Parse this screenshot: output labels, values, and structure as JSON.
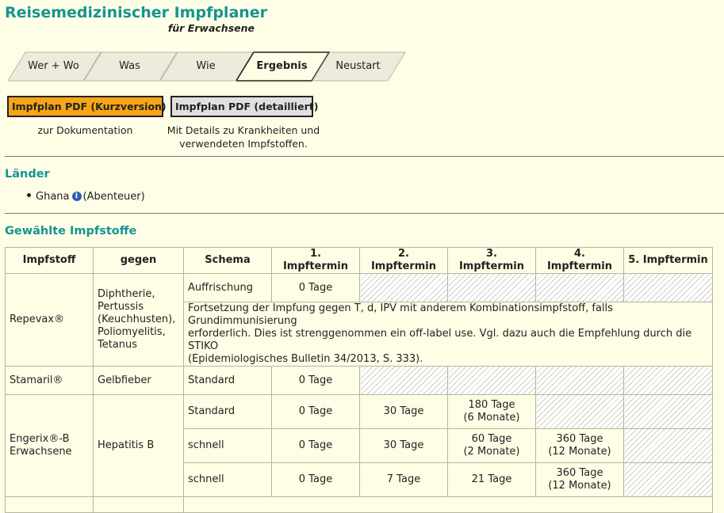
{
  "header": {
    "title": "Reisemedizinischer Impfplaner",
    "subtitle": "für Erwachsene"
  },
  "tabs": [
    {
      "label": "Wer + Wo",
      "active": false
    },
    {
      "label": "Was",
      "active": false
    },
    {
      "label": "Wie",
      "active": false
    },
    {
      "label": "Ergebnis",
      "active": true
    },
    {
      "label": "Neustart",
      "active": false
    }
  ],
  "pdf": {
    "short_label": "Impfplan PDF (Kurzversion)",
    "short_desc": "zur Dokumentation",
    "detail_label": "Impfplan PDF (detailliert)",
    "detail_desc_line1": "Mit Details zu Krankheiten und",
    "detail_desc_line2": "verwendeten Impfstoffen.",
    "short_color": "#f7a416",
    "detail_color": "#e2e0df"
  },
  "countries": {
    "heading": "Länder",
    "items": [
      {
        "name": "Ghana",
        "note": "(Abenteuer)"
      }
    ]
  },
  "vaccines": {
    "heading": "Gewählte Impfstoffe",
    "columns": [
      "Impfstoff",
      "gegen",
      "Schema",
      "1. Impftermin",
      "2. Impftermin",
      "3. Impftermin",
      "4. Impftermin",
      "5. Impftermin"
    ],
    "repevax": {
      "name": "Repevax®",
      "gegen_lines": [
        "Diphtherie,",
        "Pertussis",
        "(Keuchhusten),",
        "Poliomyelitis,",
        "Tetanus"
      ],
      "schema": "Auffrischung",
      "t1": "0 Tage",
      "note_line1": "Fortsetzung der Impfung gegen T, d, IPV mit anderem Kombinationsimpfstoff, falls Grundimmunisierung",
      "note_line2": "erforderlich. Dies ist strenggenommen ein off-label use. Vgl. dazu auch die Empfehlung durch die STIKO",
      "note_line3": "(Epidemiologisches Bulletin 34/2013, S. 333)."
    },
    "stamaril": {
      "name": "Stamaril®",
      "gegen": "Gelbfieber",
      "schema": "Standard",
      "t1": "0 Tage"
    },
    "engerix": {
      "name_line1": "Engerix®-B",
      "name_line2": "Erwachsene",
      "gegen": "Hepatitis B",
      "rows": [
        {
          "schema": "Standard",
          "t1": "0 Tage",
          "t2": "30 Tage",
          "t3a": "180 Tage",
          "t3b": "(6 Monate)"
        },
        {
          "schema": "schnell",
          "t1": "0 Tage",
          "t2": "30 Tage",
          "t3a": "60 Tage",
          "t3b": "(2 Monate)",
          "t4a": "360 Tage",
          "t4b": "(12 Monate)"
        },
        {
          "schema": "schnell",
          "t1": "0 Tage",
          "t2": "7 Tage",
          "t3": "21 Tage",
          "t4a": "360 Tage",
          "t4b": "(12 Monate)"
        }
      ]
    }
  },
  "colors": {
    "accent": "#169393",
    "background": "#fefee6"
  }
}
